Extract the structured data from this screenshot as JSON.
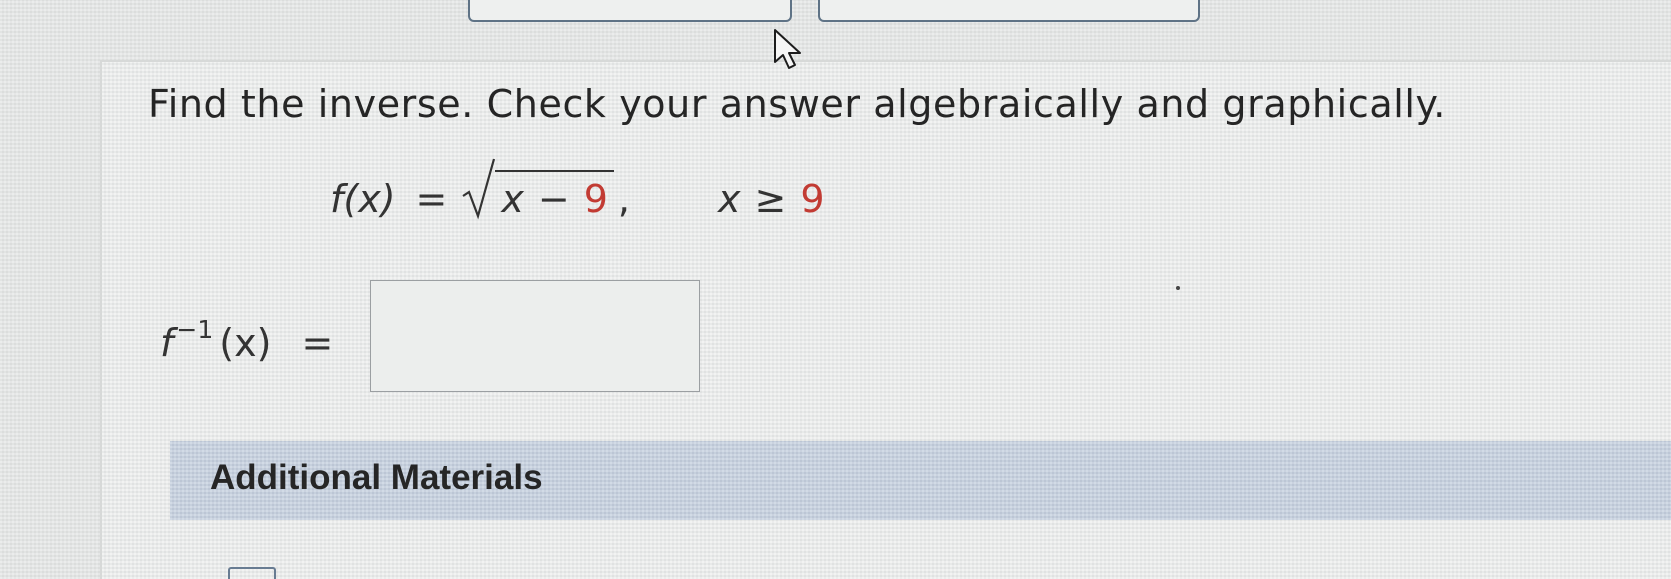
{
  "instructions": "Find the inverse. Check your answer algebraically and graphically.",
  "equation": {
    "lhs": "f(x)",
    "equals": "=",
    "radicand_var": "x",
    "radicand_op": "−",
    "radicand_num": "9",
    "comma": ",",
    "domain_var": "x",
    "domain_op": "≥",
    "domain_num": "9"
  },
  "answer": {
    "func": "f",
    "exponent": "−1",
    "arg": "(x)",
    "equals": "=",
    "value": ""
  },
  "additional_materials": {
    "title": "Additional Materials"
  },
  "colors": {
    "accent_red": "#c23b33",
    "section_header_bg": "#c5d0df",
    "top_button_border": "#5f7386"
  },
  "icons": {
    "cursor": "mouse-pointer-icon",
    "ebook": "ebook-icon"
  }
}
